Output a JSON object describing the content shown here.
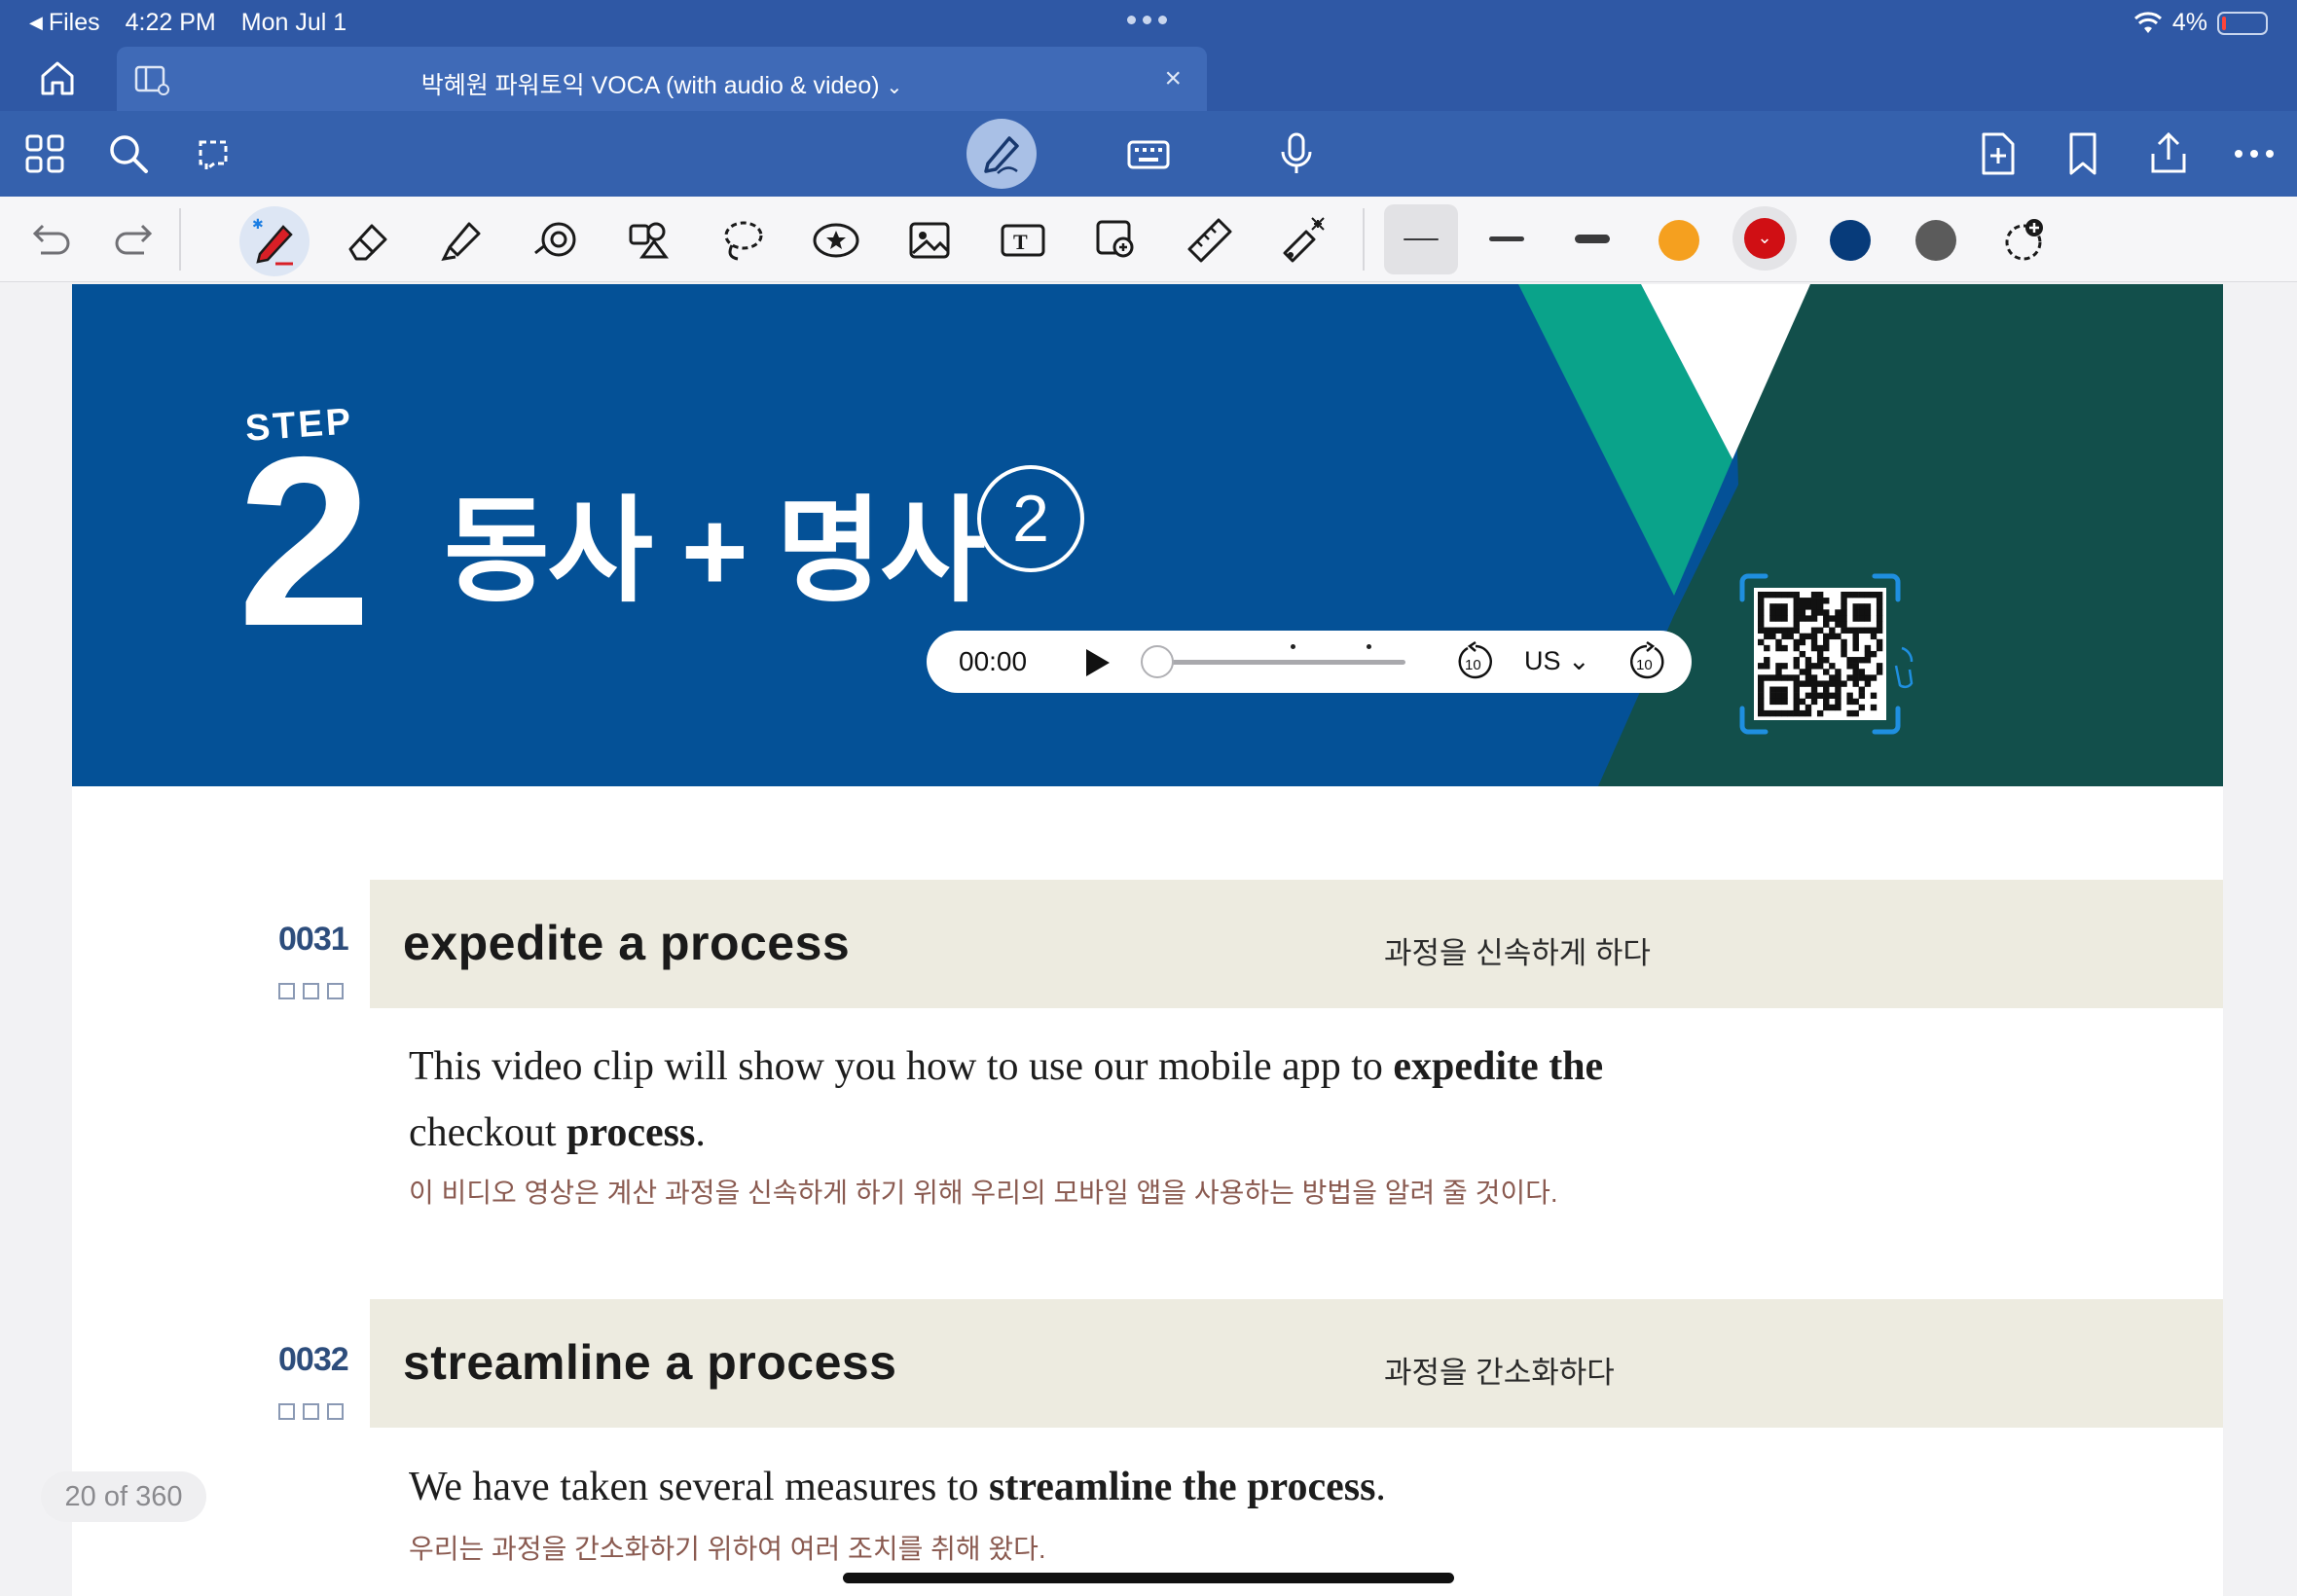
{
  "status_bar": {
    "back_app": "Files",
    "time": "4:22 PM",
    "date": "Mon Jul 1",
    "battery": "4%"
  },
  "tab": {
    "title": "박혜원 파워토익 VOCA (with audio & video)"
  },
  "banner": {
    "step_label": "STEP",
    "step_number": "2",
    "title": "동사 + 명사",
    "circle_number": "2",
    "colors": {
      "bg": "#045197",
      "teal": "#0aa38a",
      "dark_green": "#124f4b"
    }
  },
  "audio": {
    "time": "00:00",
    "language": "US",
    "skip_seconds": "10",
    "progress": 0
  },
  "toolbar_colors": [
    "#f5a01f",
    "#d00f14",
    "#073b7a",
    "#5b5b5b"
  ],
  "entries": [
    {
      "number": "0031",
      "phrase": "expedite a process",
      "meaning": "과정을 신속하게 하다",
      "example_parts": [
        {
          "text": "This video clip will show you how to use our mobile app to ",
          "bold": false
        },
        {
          "text": "expedite the",
          "bold": true
        },
        {
          "text": " checkout ",
          "bold": false
        },
        {
          "text": "process",
          "bold": true
        },
        {
          "text": ".",
          "bold": false
        }
      ],
      "translation": "이 비디오 영상은 계산 과정을 신속하게 하기 위해 우리의 모바일 앱을 사용하는 방법을 알려 줄 것이다."
    },
    {
      "number": "0032",
      "phrase": "streamline a process",
      "meaning": "과정을 간소화하다",
      "example_parts": [
        {
          "text": "We have taken several measures to ",
          "bold": false
        },
        {
          "text": "streamline the process",
          "bold": true
        },
        {
          "text": ".",
          "bold": false
        }
      ],
      "translation": "우리는 과정을 간소화하기 위하여 여러 조치를 취해 왔다."
    }
  ],
  "page_counter": "20 of 360"
}
